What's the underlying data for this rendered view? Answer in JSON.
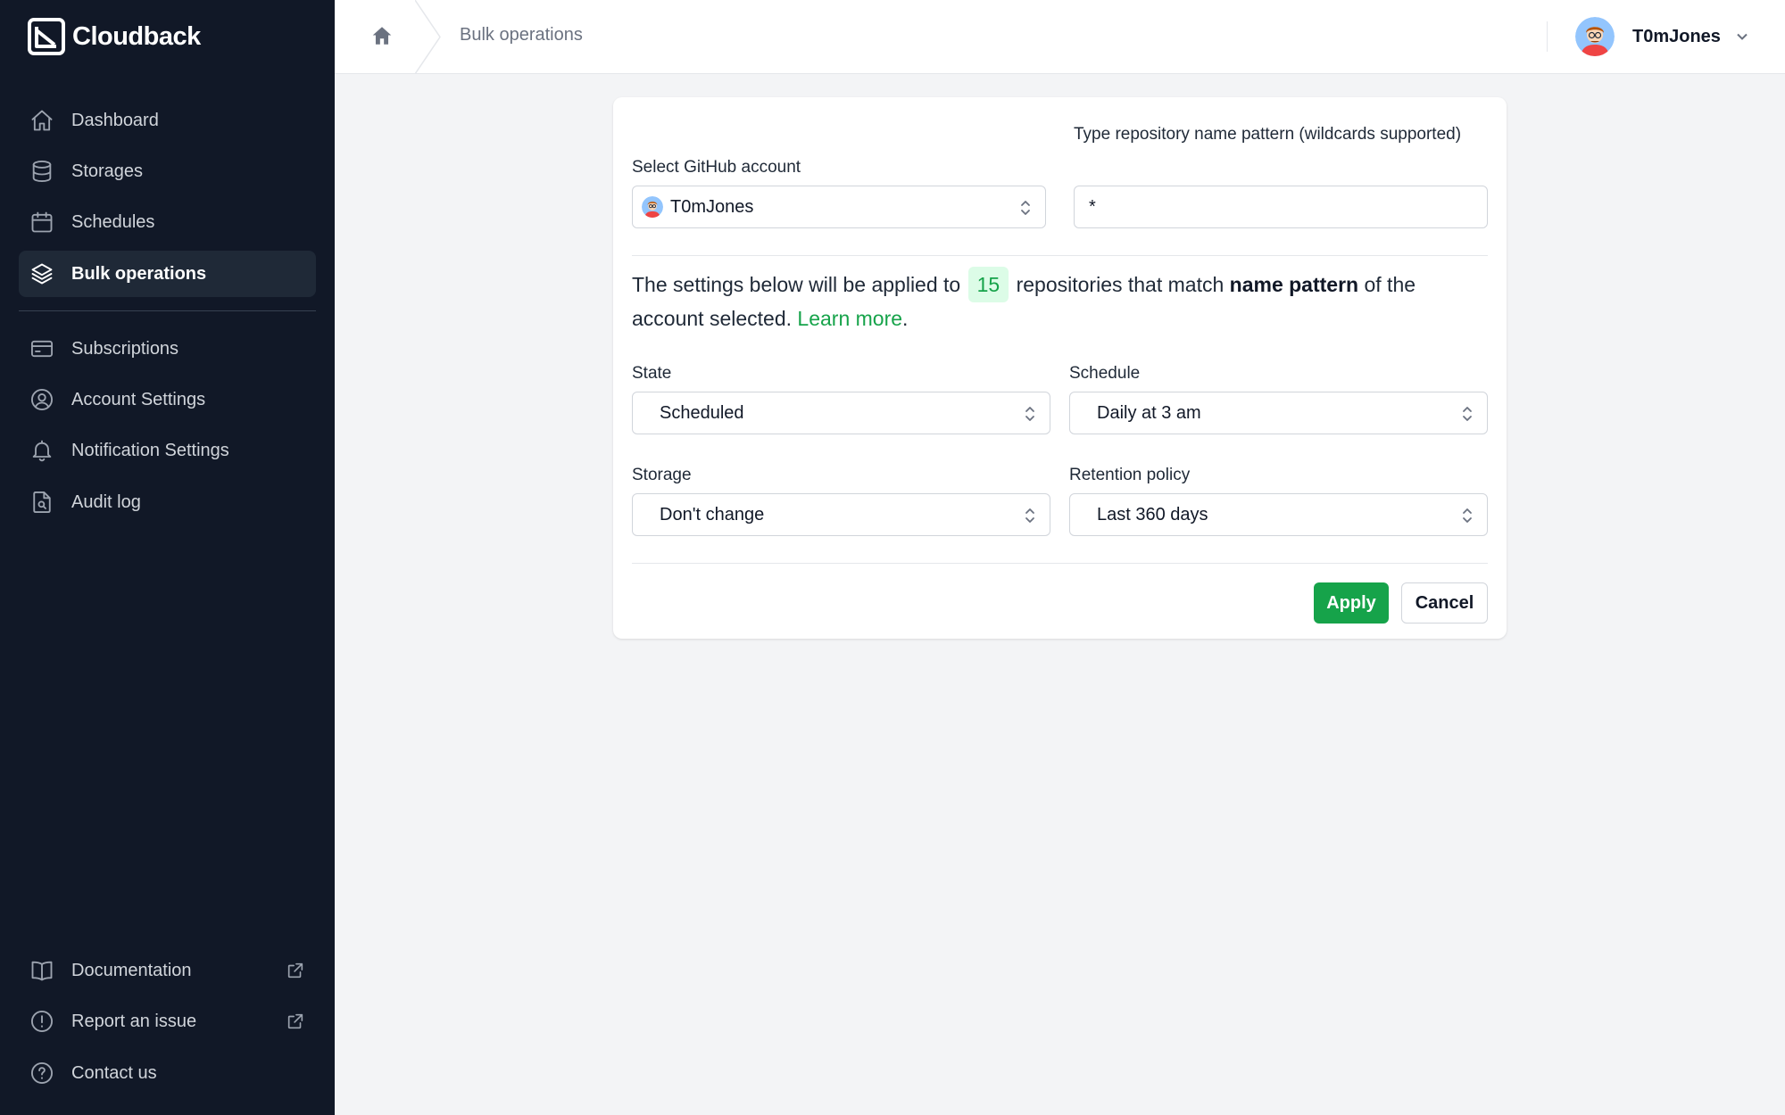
{
  "app": {
    "name": "Cloudback"
  },
  "sidebar": {
    "items": [
      {
        "label": "Dashboard",
        "icon": "home-icon"
      },
      {
        "label": "Storages",
        "icon": "database-icon"
      },
      {
        "label": "Schedules",
        "icon": "calendar-icon"
      },
      {
        "label": "Bulk operations",
        "icon": "layers-icon",
        "active": true
      },
      {
        "label": "Subscriptions",
        "icon": "credit-card-icon"
      },
      {
        "label": "Account Settings",
        "icon": "user-circle-icon"
      },
      {
        "label": "Notification Settings",
        "icon": "bell-icon"
      },
      {
        "label": "Audit log",
        "icon": "document-search-icon"
      }
    ],
    "footer": [
      {
        "label": "Documentation",
        "icon": "book-icon",
        "external": true
      },
      {
        "label": "Report an issue",
        "icon": "exclamation-circle-icon",
        "external": true
      },
      {
        "label": "Contact us",
        "icon": "question-circle-icon"
      }
    ]
  },
  "header": {
    "breadcrumb": "Bulk operations",
    "user": {
      "name": "T0mJones"
    }
  },
  "form": {
    "account_label": "Select GitHub account",
    "account_value": "T0mJones",
    "pattern_label": "Type repository name pattern (wildcards supported)",
    "pattern_value": "*",
    "info": {
      "prefix": "The settings below will be applied to",
      "count": "15",
      "middle": "repositories that match",
      "emphasis": "name pattern",
      "suffix": "of the account selected.",
      "link": "Learn more",
      "end": "."
    },
    "state_label": "State",
    "state_value": "Scheduled",
    "schedule_label": "Schedule",
    "schedule_value": "Daily at 3 am",
    "storage_label": "Storage",
    "storage_value": "Don't change",
    "retention_label": "Retention policy",
    "retention_value": "Last 360 days",
    "apply_label": "Apply",
    "cancel_label": "Cancel"
  },
  "colors": {
    "sidebar_bg": "#111827",
    "accent": "#16a34a",
    "badge_bg": "#dcfce7"
  }
}
